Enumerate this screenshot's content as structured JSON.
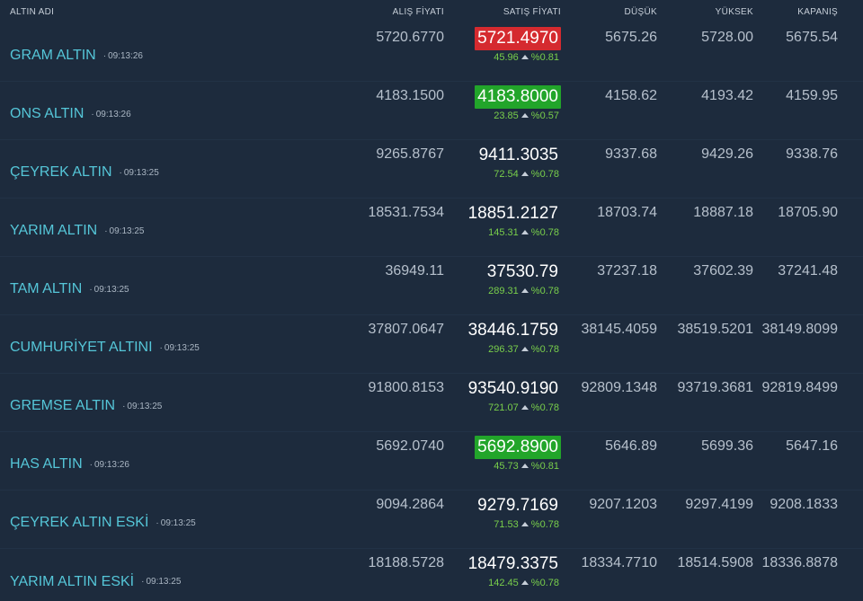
{
  "headers": {
    "name": "ALTIN ADI",
    "alis": "ALIŞ FİYATI",
    "satis": "SATIŞ FİYATI",
    "dusuk": "DÜŞÜK",
    "yuksek": "YÜKSEK",
    "kapanis": "KAPANIŞ"
  },
  "rows": [
    {
      "name": "GRAM ALTIN",
      "time": "09:13:26",
      "alis": "5720.6770",
      "satis": "5721.4970",
      "highlight": "down",
      "change": "45.96",
      "pct": "%0.81",
      "dusuk": "5675.26",
      "yuksek": "5728.00",
      "kapanis": "5675.54"
    },
    {
      "name": "ONS ALTIN",
      "time": "09:13:26",
      "alis": "4183.1500",
      "satis": "4183.8000",
      "highlight": "up",
      "change": "23.85",
      "pct": "%0.57",
      "dusuk": "4158.62",
      "yuksek": "4193.42",
      "kapanis": "4159.95"
    },
    {
      "name": "ÇEYREK ALTIN",
      "time": "09:13:25",
      "alis": "9265.8767",
      "satis": "9411.3035",
      "highlight": "none",
      "change": "72.54",
      "pct": "%0.78",
      "dusuk": "9337.68",
      "yuksek": "9429.26",
      "kapanis": "9338.76"
    },
    {
      "name": "YARIM ALTIN",
      "time": "09:13:25",
      "alis": "18531.7534",
      "satis": "18851.2127",
      "highlight": "none",
      "change": "145.31",
      "pct": "%0.78",
      "dusuk": "18703.74",
      "yuksek": "18887.18",
      "kapanis": "18705.90"
    },
    {
      "name": "TAM ALTIN",
      "time": "09:13:25",
      "alis": "36949.11",
      "satis": "37530.79",
      "highlight": "none",
      "change": "289.31",
      "pct": "%0.78",
      "dusuk": "37237.18",
      "yuksek": "37602.39",
      "kapanis": "37241.48"
    },
    {
      "name": "CUMHURİYET ALTINI",
      "time": "09:13:25",
      "alis": "37807.0647",
      "satis": "38446.1759",
      "highlight": "none",
      "change": "296.37",
      "pct": "%0.78",
      "dusuk": "38145.4059",
      "yuksek": "38519.5201",
      "kapanis": "38149.8099"
    },
    {
      "name": "GREMSE ALTIN",
      "time": "09:13:25",
      "alis": "91800.8153",
      "satis": "93540.9190",
      "highlight": "none",
      "change": "721.07",
      "pct": "%0.78",
      "dusuk": "92809.1348",
      "yuksek": "93719.3681",
      "kapanis": "92819.8499"
    },
    {
      "name": "HAS ALTIN",
      "time": "09:13:26",
      "alis": "5692.0740",
      "satis": "5692.8900",
      "highlight": "up",
      "change": "45.73",
      "pct": "%0.81",
      "dusuk": "5646.89",
      "yuksek": "5699.36",
      "kapanis": "5647.16"
    },
    {
      "name": "ÇEYREK ALTIN ESKİ",
      "time": "09:13:25",
      "alis": "9094.2864",
      "satis": "9279.7169",
      "highlight": "none",
      "change": "71.53",
      "pct": "%0.78",
      "dusuk": "9207.1203",
      "yuksek": "9297.4199",
      "kapanis": "9208.1833"
    },
    {
      "name": "YARIM ALTIN ESKİ",
      "time": "09:13:25",
      "alis": "18188.5728",
      "satis": "18479.3375",
      "highlight": "none",
      "change": "142.45",
      "pct": "%0.78",
      "dusuk": "18334.7710",
      "yuksek": "18514.5908",
      "kapanis": "18336.8878"
    }
  ],
  "colors": {
    "background": "#1d2b3d",
    "name": "#55c6d8",
    "up_highlight": "#22a52a",
    "down_highlight": "#d52a2f",
    "change": "#79cf4b"
  }
}
